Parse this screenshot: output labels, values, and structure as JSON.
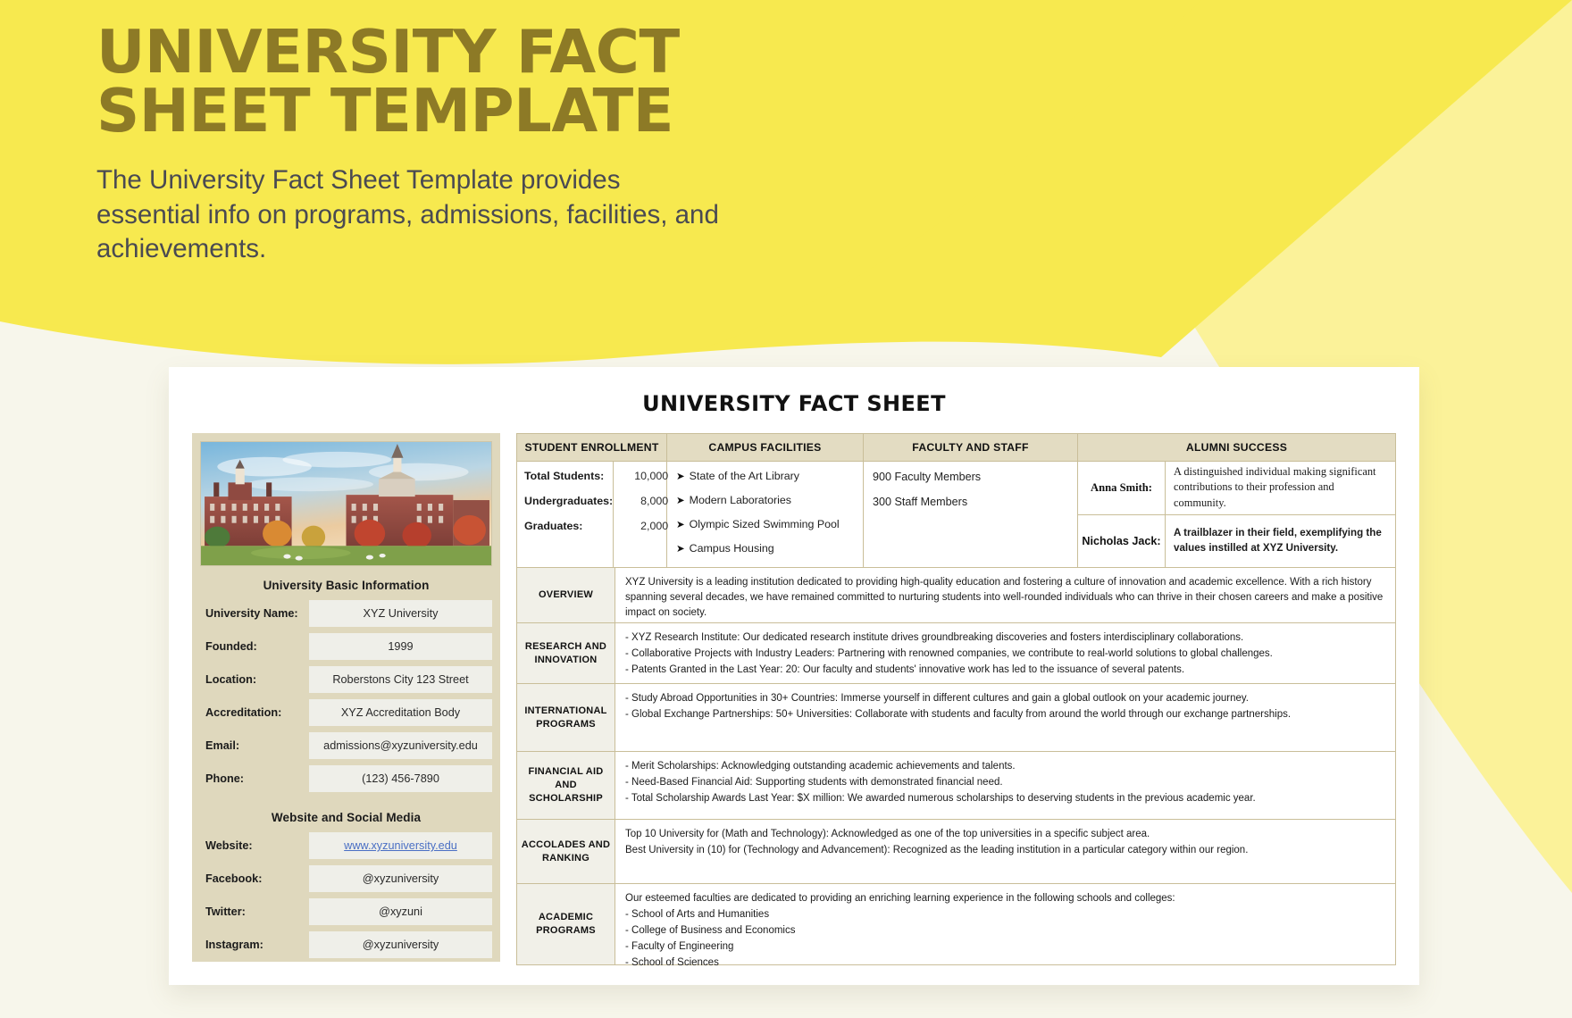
{
  "hero": {
    "title_line1": "UNIVERSITY FACT",
    "title_line2": "SHEET TEMPLATE",
    "subtitle": "The University Fact Sheet Template provides essential info on programs, admissions, facilities, and achievements."
  },
  "colors": {
    "yellow_bright": "#F7E94F",
    "yellow_light": "#FBF299",
    "cream": "#F7F6EB",
    "title_gold": "#8D7A26",
    "panel_tan": "#DFD8BD",
    "header_tan": "#E3DCC2",
    "border_tan": "#C9BE99",
    "field_bg": "#EFEFE9",
    "link_blue": "#4A6FC4"
  },
  "document": {
    "title": "UNIVERSITY FACT SHEET"
  },
  "photo": {
    "alt": "campus-photo",
    "caption": "University Basic Information"
  },
  "basic_info": {
    "heading": "University Basic Information",
    "fields": [
      {
        "label": "University Name:",
        "value": "XYZ University"
      },
      {
        "label": "Founded:",
        "value": "1999"
      },
      {
        "label": "Location:",
        "value": "Roberstons City 123 Street"
      },
      {
        "label": "Accreditation:",
        "value": "XYZ Accreditation Body"
      },
      {
        "label": "Email:",
        "value": "admissions@xyzuniversity.edu"
      },
      {
        "label": "Phone:",
        "value": "(123) 456-7890"
      }
    ]
  },
  "social": {
    "heading": "Website and Social Media",
    "fields": [
      {
        "label": "Website:",
        "value": "www.xyzuniversity.edu"
      },
      {
        "label": "Facebook:",
        "value": "@xyzuniversity"
      },
      {
        "label": "Twitter:",
        "value": "@xyzuni"
      },
      {
        "label": "Instagram:",
        "value": "@xyzuniversity"
      }
    ]
  },
  "top_table": {
    "headers": {
      "enrollment": "STUDENT ENROLLMENT",
      "facilities": "CAMPUS FACILITIES",
      "faculty": "FACULTY AND STAFF",
      "alumni": "ALUMNI SUCCESS"
    },
    "enrollment": [
      {
        "label": "Total Students:",
        "value": "10,000"
      },
      {
        "label": "Undergraduates:",
        "value": "8,000"
      },
      {
        "label": "Graduates:",
        "value": "2,000"
      }
    ],
    "facilities": [
      "State of the Art Library",
      "Modern Laboratories",
      "Olympic Sized Swimming Pool",
      "Campus Housing"
    ],
    "facility_bullet": "➤",
    "faculty": [
      "900 Faculty Members",
      "300 Staff Members"
    ],
    "alumni": [
      {
        "name": "Anna Smith:",
        "description": "A distinguished individual making significant contributions to their profession and community."
      },
      {
        "name": "Nicholas Jack:",
        "description": "A trailblazer in their field, exemplifying the values instilled at XYZ University."
      }
    ]
  },
  "sections": [
    {
      "label": "OVERVIEW",
      "lines": [
        "XYZ University is a leading institution dedicated to providing high-quality education and fostering a culture of innovation and academic excellence. With a rich history spanning several decades, we have remained committed to nurturing students into well-rounded individuals who can thrive in their chosen careers and make a positive impact on society."
      ]
    },
    {
      "label": "RESEARCH AND INNOVATION",
      "lines": [
        "- XYZ Research Institute: Our dedicated research institute drives groundbreaking discoveries and fosters interdisciplinary collaborations.",
        "- Collaborative Projects with Industry Leaders: Partnering with renowned companies, we contribute to real-world solutions to global challenges.",
        "- Patents Granted in the Last Year: 20: Our faculty and students' innovative work has led to the issuance of several patents."
      ]
    },
    {
      "label": "INTERNATIONAL PROGRAMS",
      "lines": [
        "- Study Abroad Opportunities in 30+ Countries: Immerse yourself in different cultures and gain a global outlook on your academic journey.",
        "- Global Exchange Partnerships: 50+ Universities: Collaborate with students and faculty from around the world through our exchange partnerships."
      ]
    },
    {
      "label": "FINANCIAL AID AND SCHOLARSHIP",
      "lines": [
        "- Merit Scholarships: Acknowledging outstanding academic achievements and talents.",
        "- Need-Based Financial Aid: Supporting students with demonstrated financial need.",
        "- Total Scholarship Awards Last Year: $X million: We awarded numerous scholarships to deserving students in the previous academic year."
      ]
    },
    {
      "label": "ACCOLADES AND RANKING",
      "lines": [
        "Top 10 University for (Math and Technology): Acknowledged as one of the top universities in a specific subject area.",
        "Best University in (10) for (Technology and Advancement): Recognized as the leading institution in a particular category within our region."
      ]
    },
    {
      "label": "ACADEMIC PROGRAMS",
      "lines": [
        "Our esteemed faculties are dedicated to providing an enriching learning experience in the following schools and colleges:",
        "- School of Arts and Humanities",
        "- College of Business and Economics",
        "- Faculty of Engineering",
        "- School of Sciences"
      ]
    }
  ]
}
